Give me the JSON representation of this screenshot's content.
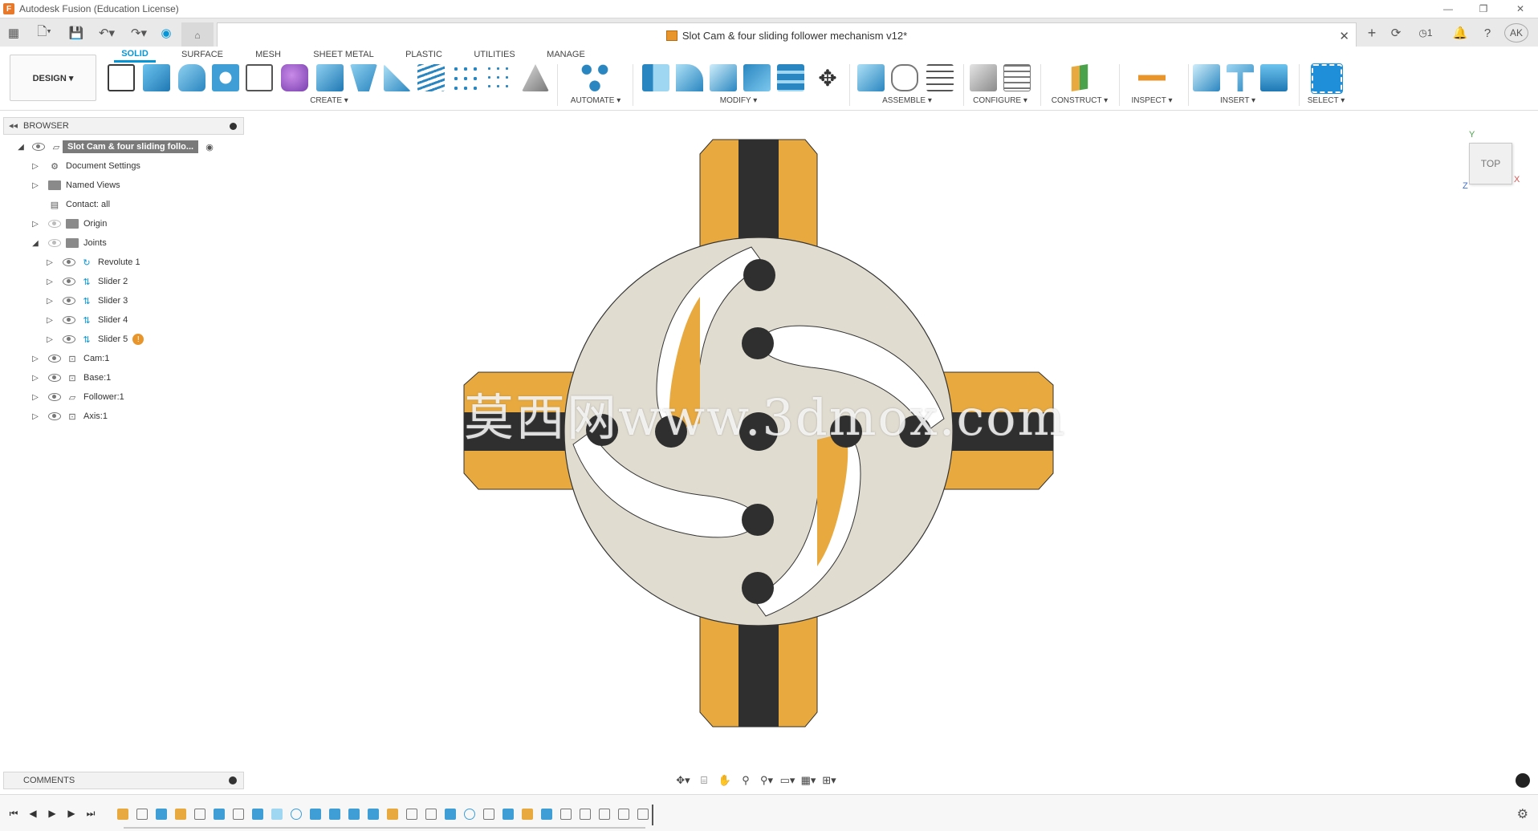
{
  "window": {
    "app_title": "Autodesk Fusion (Education License)",
    "doc_title": "Slot Cam & four sliding follower mechanism v12*",
    "user_initials": "AK",
    "notifications_count": "1"
  },
  "ribbon": {
    "workspace_button": "DESIGN ▾",
    "tabs": [
      "SOLID",
      "SURFACE",
      "MESH",
      "SHEET METAL",
      "PLASTIC",
      "UTILITIES",
      "MANAGE"
    ],
    "groups": [
      "CREATE ▾",
      "AUTOMATE ▾",
      "MODIFY ▾",
      "ASSEMBLE ▾",
      "CONFIGURE ▾",
      "CONSTRUCT ▾",
      "INSPECT ▾",
      "INSERT ▾",
      "SELECT ▾"
    ]
  },
  "browser": {
    "title": "BROWSER",
    "root": "Slot Cam & four sliding follo...",
    "items": [
      {
        "label": "Document Settings"
      },
      {
        "label": "Named Views"
      },
      {
        "label": "Contact: all"
      },
      {
        "label": "Origin"
      },
      {
        "label": "Joints"
      },
      {
        "label": "Revolute 1"
      },
      {
        "label": "Slider 2"
      },
      {
        "label": "Slider 3"
      },
      {
        "label": "Slider 4"
      },
      {
        "label": "Slider 5"
      },
      {
        "label": "Cam:1"
      },
      {
        "label": "Base:1"
      },
      {
        "label": "Follower:1"
      },
      {
        "label": "Axis:1"
      }
    ]
  },
  "viewcube": {
    "face": "TOP",
    "axis_y": "Y",
    "axis_x": "X",
    "axis_z": "Z"
  },
  "watermark": "莫西网www.3dmox.com",
  "comments": {
    "title": "COMMENTS"
  },
  "colors": {
    "accent": "#0696d7",
    "follower_orange": "#e8a93e",
    "slot_dark": "#2f2f2f",
    "cam_beige": "#e0dcd0"
  }
}
